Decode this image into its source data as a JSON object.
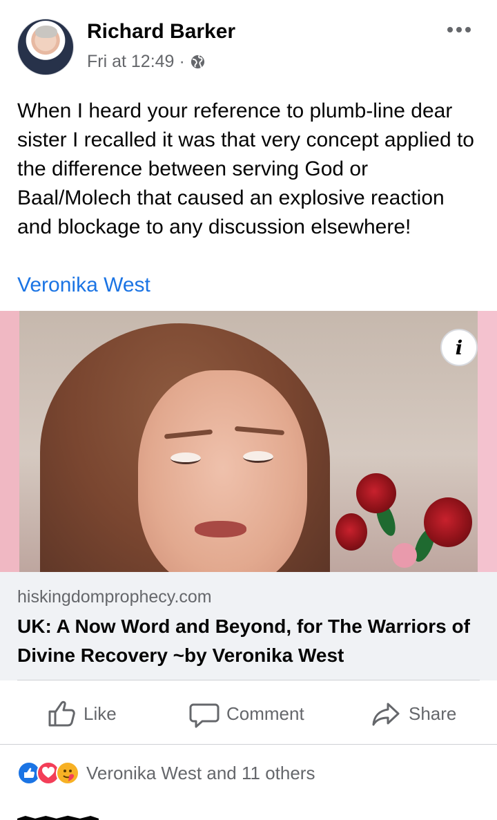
{
  "post": {
    "author": "Richard Barker",
    "timestamp": "Fri at 12:49",
    "separator": "·",
    "privacy_icon": "globe-icon",
    "more_icon": "more-dots-icon",
    "text": "When I heard your reference to plumb-line dear sister I recalled it was that very concept applied to the difference between serving God or Baal/Molech that caused an explosive reaction and blockage to any discussion elsewhere!",
    "mention": "Veronika West"
  },
  "link_preview": {
    "info_label": "i",
    "domain": "hiskingdomprophecy.com",
    "title": "UK: A Now Word and Beyond, for The Warriors of Divine Recovery ~by Veronika West"
  },
  "actions": {
    "like": "Like",
    "comment": "Comment",
    "share": "Share"
  },
  "reactions": {
    "icons": [
      "like-reaction-icon",
      "love-reaction-icon",
      "care-reaction-icon"
    ],
    "summary": "Veronika West and 11 others"
  },
  "colors": {
    "accent": "#1b74e4",
    "text": "#050505",
    "secondary_text": "#65676b",
    "link_card_background": "#f0f2f5"
  }
}
